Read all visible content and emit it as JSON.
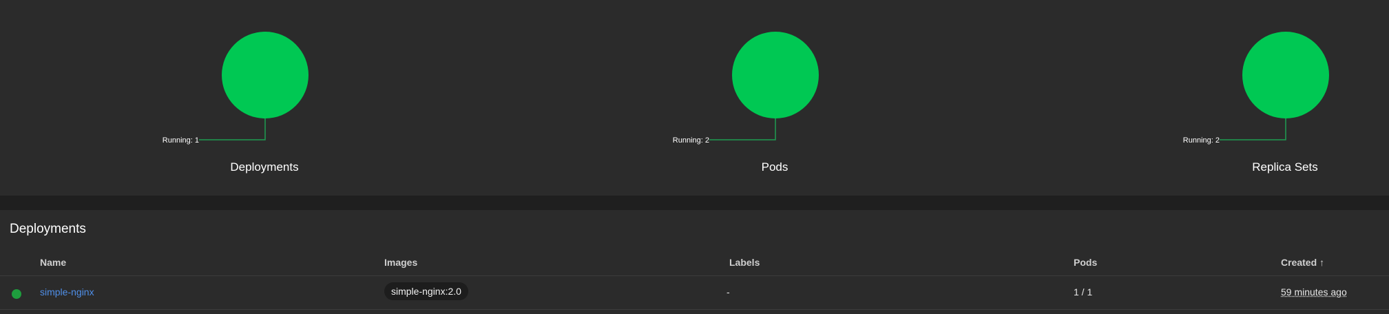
{
  "status": {
    "accent_color": "#00c853",
    "charts": [
      {
        "id": "deployments",
        "title": "Deployments",
        "label": "Running: 1",
        "running": 1
      },
      {
        "id": "pods",
        "title": "Pods",
        "label": "Running: 2",
        "running": 2
      },
      {
        "id": "replica-sets",
        "title": "Replica Sets",
        "label": "Running: 2",
        "running": 2
      }
    ]
  },
  "deployments": {
    "title": "Deployments",
    "columns": {
      "name": "Name",
      "images": "Images",
      "labels": "Labels",
      "pods": "Pods",
      "created": "Created"
    },
    "sort_icon": "arrow-up-icon",
    "rows": [
      {
        "status": "running",
        "name": "simple-nginx",
        "image": "simple-nginx:2.0",
        "labels": "-",
        "pods": "1 / 1",
        "created": "59 minutes ago"
      }
    ]
  }
}
